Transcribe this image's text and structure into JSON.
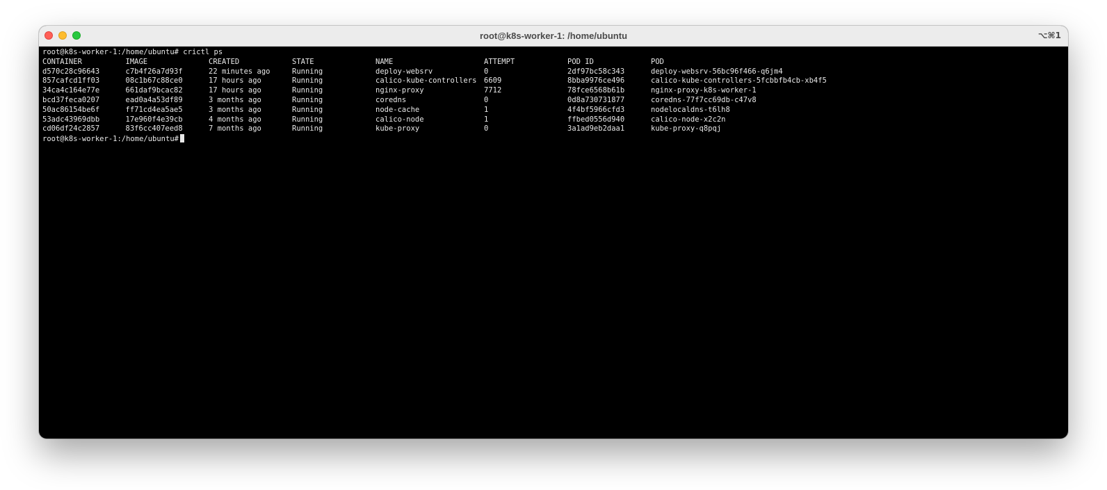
{
  "window": {
    "title": "root@k8s-worker-1: /home/ubuntu",
    "shortcut": "⌥⌘1"
  },
  "terminal": {
    "prompt": "root@k8s-worker-1:/home/ubuntu#",
    "command": "crictl ps",
    "headers": [
      "CONTAINER",
      "IMAGE",
      "CREATED",
      "STATE",
      "NAME",
      "ATTEMPT",
      "POD ID",
      "POD"
    ],
    "rows": [
      [
        "d570c28c96643",
        "c7b4f26a7d93f",
        "22 minutes ago",
        "Running",
        "deploy-websrv",
        "0",
        "2df97bc58c343",
        "deploy-websrv-56bc96f466-q6jm4"
      ],
      [
        "857cafcd1ff03",
        "08c1b67c88ce0",
        "17 hours ago",
        "Running",
        "calico-kube-controllers",
        "6609",
        "8bba9976ce496",
        "calico-kube-controllers-5fcbbfb4cb-xb4f5"
      ],
      [
        "34ca4c164e77e",
        "661daf9bcac82",
        "17 hours ago",
        "Running",
        "nginx-proxy",
        "7712",
        "78fce6568b61b",
        "nginx-proxy-k8s-worker-1"
      ],
      [
        "bcd37feca0207",
        "ead0a4a53df89",
        "3 months ago",
        "Running",
        "coredns",
        "0",
        "0d8a730731877",
        "coredns-77f7cc69db-c47v8"
      ],
      [
        "50ac86154be6f",
        "ff71cd4ea5ae5",
        "3 months ago",
        "Running",
        "node-cache",
        "1",
        "4f4bf5966cfd3",
        "nodelocaldns-t6lh8"
      ],
      [
        "53adc43969dbb",
        "17e960f4e39cb",
        "4 months ago",
        "Running",
        "calico-node",
        "1",
        "ffbed0556d940",
        "calico-node-x2c2n"
      ],
      [
        "cd06df24c2857",
        "83f6cc407eed8",
        "7 months ago",
        "Running",
        "kube-proxy",
        "0",
        "3a1ad9eb2daa1",
        "kube-proxy-q8pqj"
      ]
    ]
  }
}
